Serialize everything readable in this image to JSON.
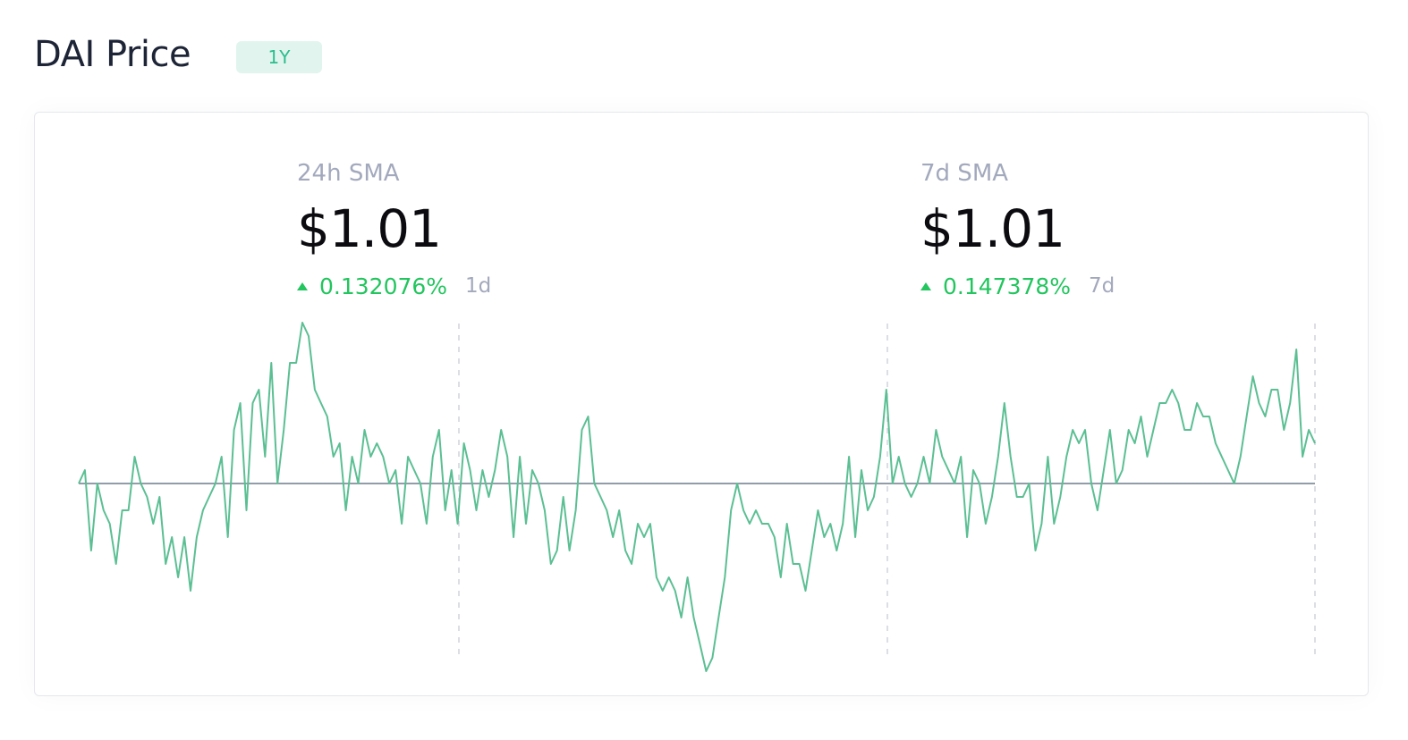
{
  "header": {
    "title": "DAI Price",
    "period_pill": "1Y"
  },
  "stats": [
    {
      "label": "24h SMA",
      "value": "$1.01",
      "change": "0.132076%",
      "period": "1d"
    },
    {
      "label": "7d SMA",
      "value": "$1.01",
      "change": "0.147378%",
      "period": "7d"
    }
  ],
  "colors": {
    "line": "#5bbf93",
    "baseline": "#6f7d8e",
    "positive": "#22c55e",
    "pill_bg": "#e1f5ee",
    "pill_text": "#2dbd8e",
    "muted": "#a3a9bd"
  },
  "chart_data": {
    "type": "line",
    "title": "",
    "xlabel": "",
    "ylabel": "",
    "baseline": 1.0,
    "grid": "three dashed vertical lines",
    "series": [
      {
        "values": [
          1.0,
          1.0005,
          0.9975,
          1.0,
          0.999,
          0.9985,
          0.997,
          0.999,
          0.999,
          1.001,
          1.0,
          0.9995,
          0.9985,
          0.9995,
          0.997,
          0.998,
          0.9965,
          0.998,
          0.996,
          0.998,
          0.999,
          0.9995,
          1.0,
          1.001,
          0.998,
          1.002,
          1.003,
          0.999,
          1.003,
          1.0035,
          1.001,
          1.0045,
          1.0,
          1.002,
          1.0045,
          1.0045,
          1.006,
          1.0055,
          1.0035,
          1.003,
          1.0025,
          1.001,
          1.0015,
          0.999,
          1.001,
          1.0,
          1.002,
          1.001,
          1.0015,
          1.001,
          1.0,
          1.0005,
          0.9985,
          1.001,
          1.0005,
          1.0,
          0.9985,
          1.001,
          1.002,
          0.999,
          1.0005,
          0.9985,
          1.0015,
          1.0005,
          0.999,
          1.0005,
          0.9995,
          1.0005,
          1.002,
          1.001,
          0.998,
          1.001,
          0.9985,
          1.0005,
          1.0,
          0.999,
          0.997,
          0.9975,
          0.9995,
          0.9975,
          0.999,
          1.002,
          1.0025,
          1.0,
          0.9995,
          0.999,
          0.998,
          0.999,
          0.9975,
          0.997,
          0.9985,
          0.998,
          0.9985,
          0.9965,
          0.996,
          0.9965,
          0.996,
          0.995,
          0.9965,
          0.995,
          0.994,
          0.993,
          0.9935,
          0.995,
          0.9965,
          0.999,
          1.0,
          0.999,
          0.9985,
          0.999,
          0.9985,
          0.9985,
          0.998,
          0.9965,
          0.9985,
          0.997,
          0.997,
          0.996,
          0.9975,
          0.999,
          0.998,
          0.9985,
          0.9975,
          0.9985,
          1.001,
          0.998,
          1.0005,
          0.999,
          0.9995,
          1.001,
          1.0035,
          1.0,
          1.001,
          1.0,
          0.9995,
          1.0,
          1.001,
          1.0,
          1.002,
          1.001,
          1.0005,
          1.0,
          1.001,
          0.998,
          1.0005,
          1.0,
          0.9985,
          0.9995,
          1.001,
          1.003,
          1.001,
          0.9995,
          0.9995,
          1.0,
          0.9975,
          0.9985,
          1.001,
          0.9985,
          0.9995,
          1.001,
          1.002,
          1.0015,
          1.002,
          1.0,
          0.999,
          1.0005,
          1.002,
          1.0,
          1.0005,
          1.002,
          1.0015,
          1.0025,
          1.001,
          1.002,
          1.003,
          1.003,
          1.0035,
          1.003,
          1.002,
          1.002,
          1.003,
          1.0025,
          1.0025,
          1.0015,
          1.001,
          1.0005,
          1.0,
          1.001,
          1.0025,
          1.004,
          1.003,
          1.0025,
          1.0035,
          1.0035,
          1.002,
          1.003,
          1.005,
          1.001,
          1.002,
          1.0015
        ]
      }
    ]
  }
}
